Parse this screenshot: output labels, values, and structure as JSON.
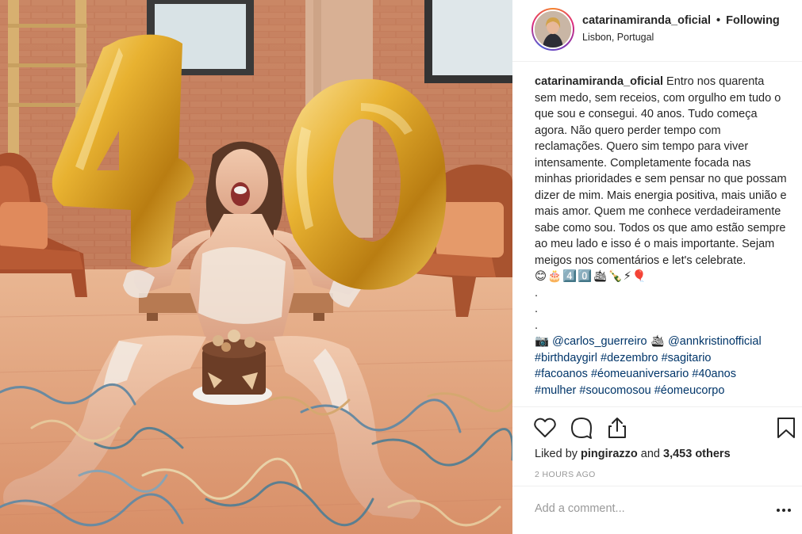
{
  "header": {
    "username": "catarinamiranda_oficial",
    "separator": "•",
    "follow_state": "Following",
    "location": "Lisbon, Portugal"
  },
  "caption": {
    "username": "catarinamiranda_oficial",
    "text": "Entro nos quarenta sem medo, sem receios, com orgulho em tudo o que sou e consegui. 40 anos. Tudo começa agora. Não quero perder tempo com reclamações. Quero sim tempo para viver intensamente. Completamente focada nas minhas prioridades e sem pensar no que possam dizer de mim. Mais energia positiva, mais união e mais amor. Quem me conhece verdadeiramente sabe como sou. Todos os que amo estão sempre ao meu lado e isso é o mais importante. Sejam meigos nos comentários e let's celebrate.",
    "emoji_line": "😊🎂4️⃣0️⃣🛳🍾⚡🎈",
    "dots": [
      ".",
      ".",
      "."
    ],
    "mention_prefix": "📷",
    "mention_1": "@carlos_guerreiro",
    "mention_sep": "🛳",
    "mention_2": "@annkristinofficial",
    "hashtags_line1": [
      "#birthdaygirl",
      "#dezembro",
      "#sagitario"
    ],
    "hashtags_line2": [
      "#facoanos",
      "#éomeuaniversario",
      "#40anos"
    ],
    "hashtags_line3": [
      "#mulher",
      "#soucomosou",
      "#éomeucorpo"
    ]
  },
  "actions": {
    "like_icon": "heart-icon",
    "comment_icon": "comment-icon",
    "share_icon": "share-icon",
    "save_icon": "bookmark-icon"
  },
  "likes": {
    "prefix": "Liked by",
    "user": "pingirazzo",
    "middle": "and",
    "others": "3,453 others"
  },
  "timestamp": "2 HOURS AGO",
  "comment": {
    "placeholder": "Add a comment...",
    "more_label": "..."
  },
  "colors": {
    "link": "#003569",
    "text": "#262626",
    "muted": "#999999",
    "balloon_gold": "#e0a92b"
  }
}
